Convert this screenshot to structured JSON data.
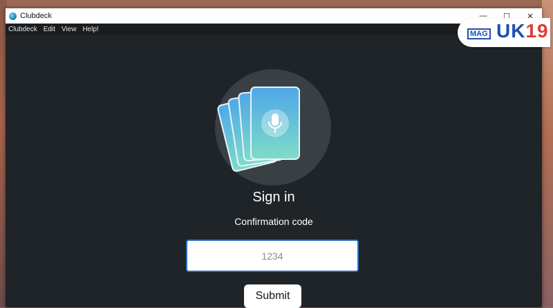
{
  "window": {
    "title": "Clubdeck",
    "controls": {
      "minimize": "—",
      "maximize": "☐",
      "close": "✕"
    }
  },
  "menu": [
    "Clubdeck",
    "Edit",
    "View",
    "Help!"
  ],
  "signin": {
    "heading": "Sign in",
    "code_label": "Confirmation code",
    "code_placeholder": "1234",
    "submit_label": "Submit"
  },
  "watermark": {
    "mag": "MAG",
    "brand_prefix": "UK",
    "brand_suffix": "19"
  },
  "colors": {
    "window_bg": "#1f2428",
    "input_border": "#2d6fc2",
    "logo_circle": "#3a3f44"
  },
  "icons": {
    "app": "clubdeck-app-icon",
    "logo": "cards-microphone-icon"
  }
}
